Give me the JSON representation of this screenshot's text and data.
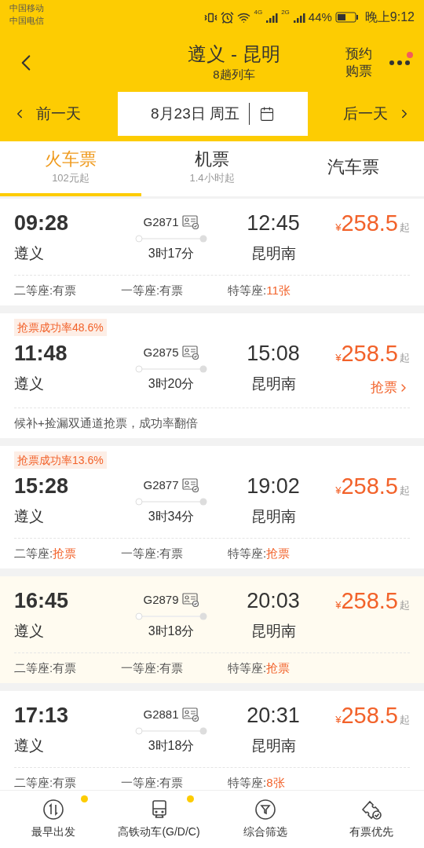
{
  "status_bar": {
    "carriers": [
      "中国移动",
      "中国电信"
    ],
    "net1": "4G",
    "net2": "2G",
    "battery": "44%",
    "time": "晚上9:12"
  },
  "header": {
    "title": "遵义 - 昆明",
    "subtitle": "8趟列车",
    "reserve": [
      "预约",
      "购票"
    ],
    "more_badge": true
  },
  "date_bar": {
    "prev": "前一天",
    "date": "8月23日 周五",
    "next": "后一天"
  },
  "tabs": [
    {
      "label": "火车票",
      "sub": "102元起",
      "selected": true
    },
    {
      "label": "机票",
      "sub": "1.4小时起",
      "selected": false
    },
    {
      "label": "汽车票",
      "selected": false
    }
  ],
  "trains": [
    {
      "depart": "09:28",
      "train_no": "G2871",
      "arrive": "12:45",
      "currency": "¥",
      "price": "258.5",
      "price_suffix": "起",
      "from": "遵义",
      "duration": "3时17分",
      "to": "昆明南",
      "tinted": false,
      "seats": [
        {
          "label": "二等座:",
          "value": "有票",
          "highlight": false
        },
        {
          "label": "一等座:",
          "value": "有票",
          "highlight": false
        },
        {
          "label": "特等座:",
          "value": "11张",
          "highlight": true
        }
      ]
    },
    {
      "badge": "抢票成功率48.6%",
      "depart": "11:48",
      "train_no": "G2875",
      "arrive": "15:08",
      "currency": "¥",
      "price": "258.5",
      "price_suffix": "起",
      "from": "遵义",
      "duration": "3时20分",
      "to": "昆明南",
      "action": "抢票",
      "tinted": false,
      "note": "候补+捡漏双通道抢票，成功率翻倍"
    },
    {
      "badge": "抢票成功率13.6%",
      "depart": "15:28",
      "train_no": "G2877",
      "arrive": "19:02",
      "currency": "¥",
      "price": "258.5",
      "price_suffix": "起",
      "from": "遵义",
      "duration": "3时34分",
      "to": "昆明南",
      "tinted": false,
      "seats": [
        {
          "label": "二等座:",
          "value": "抢票",
          "highlight": true
        },
        {
          "label": "一等座:",
          "value": "有票",
          "highlight": false
        },
        {
          "label": "特等座:",
          "value": "抢票",
          "highlight": true
        }
      ]
    },
    {
      "depart": "16:45",
      "train_no": "G2879",
      "arrive": "20:03",
      "currency": "¥",
      "price": "258.5",
      "price_suffix": "起",
      "from": "遵义",
      "duration": "3时18分",
      "to": "昆明南",
      "tinted": true,
      "seats": [
        {
          "label": "二等座:",
          "value": "有票",
          "highlight": false
        },
        {
          "label": "一等座:",
          "value": "有票",
          "highlight": false
        },
        {
          "label": "特等座:",
          "value": "抢票",
          "highlight": true
        }
      ]
    },
    {
      "depart": "17:13",
      "train_no": "G2881",
      "arrive": "20:31",
      "currency": "¥",
      "price": "258.5",
      "price_suffix": "起",
      "from": "遵义",
      "duration": "3时18分",
      "to": "昆明南",
      "tinted": false,
      "seats": [
        {
          "label": "二等座:",
          "value": "有票",
          "highlight": false
        },
        {
          "label": "一等座:",
          "value": "有票",
          "highlight": false
        },
        {
          "label": "特等座:",
          "value": "8张",
          "highlight": true
        }
      ]
    }
  ],
  "bottom_nav": [
    {
      "kind": "sort",
      "label": "最早出发",
      "dot": true
    },
    {
      "kind": "train",
      "label": "高铁动车(G/D/C)",
      "dot": true
    },
    {
      "kind": "filter",
      "label": "综合筛选",
      "dot": false
    },
    {
      "kind": "ticket",
      "label": "有票优先",
      "dot": false
    }
  ]
}
